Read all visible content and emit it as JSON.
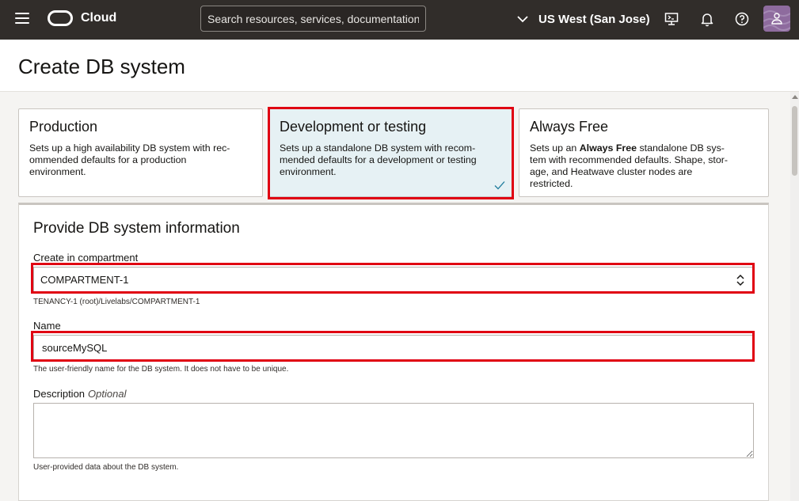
{
  "header": {
    "brand": "Cloud",
    "search_placeholder": "Search resources, services, documentation,",
    "region": "US West (San Jose)",
    "icons": [
      "hamburger-menu-icon",
      "oracle-logo",
      "chevron-down-icon",
      "cloud-shell-icon",
      "bell-icon",
      "help-icon",
      "user-icon"
    ],
    "bg_color": "#312d2a"
  },
  "page": {
    "title": "Create DB system"
  },
  "options": [
    {
      "title": "Production",
      "desc_lines": [
        "Sets up a high availability DB system with rec-",
        "ommended defaults for a production",
        "environment."
      ],
      "selected": false
    },
    {
      "title": "Development or testing",
      "desc_lines": [
        "Sets up a standalone DB system with recom-",
        "mended defaults for a development or testing",
        "environment."
      ],
      "selected": true
    },
    {
      "title": "Always Free",
      "desc_line1_pre": "Sets up an ",
      "desc_line1_bold": "Always Free",
      "desc_line1_post": " standalone DB sys-",
      "desc_lines_rest": [
        "tem with recommended defaults. Shape, stor-",
        "age, and Heatwave cluster nodes are",
        "restricted."
      ],
      "selected": false
    }
  ],
  "form": {
    "title": "Provide DB system information",
    "compartment": {
      "label": "Create in compartment",
      "value": "COMPARTMENT-1",
      "path": "TENANCY-1 (root)/Livelabs/COMPARTMENT-1"
    },
    "name": {
      "label": "Name",
      "value": "sourceMySQL",
      "help": "The user-friendly name for the DB system. It does not have to be unique."
    },
    "description": {
      "label": "Description",
      "optional": "Optional",
      "value": "",
      "help": "User-provided data about the DB system."
    }
  },
  "colors": {
    "highlight": "#e00012",
    "selected_card": "#e6f1f4",
    "accent": "#227e9e"
  }
}
